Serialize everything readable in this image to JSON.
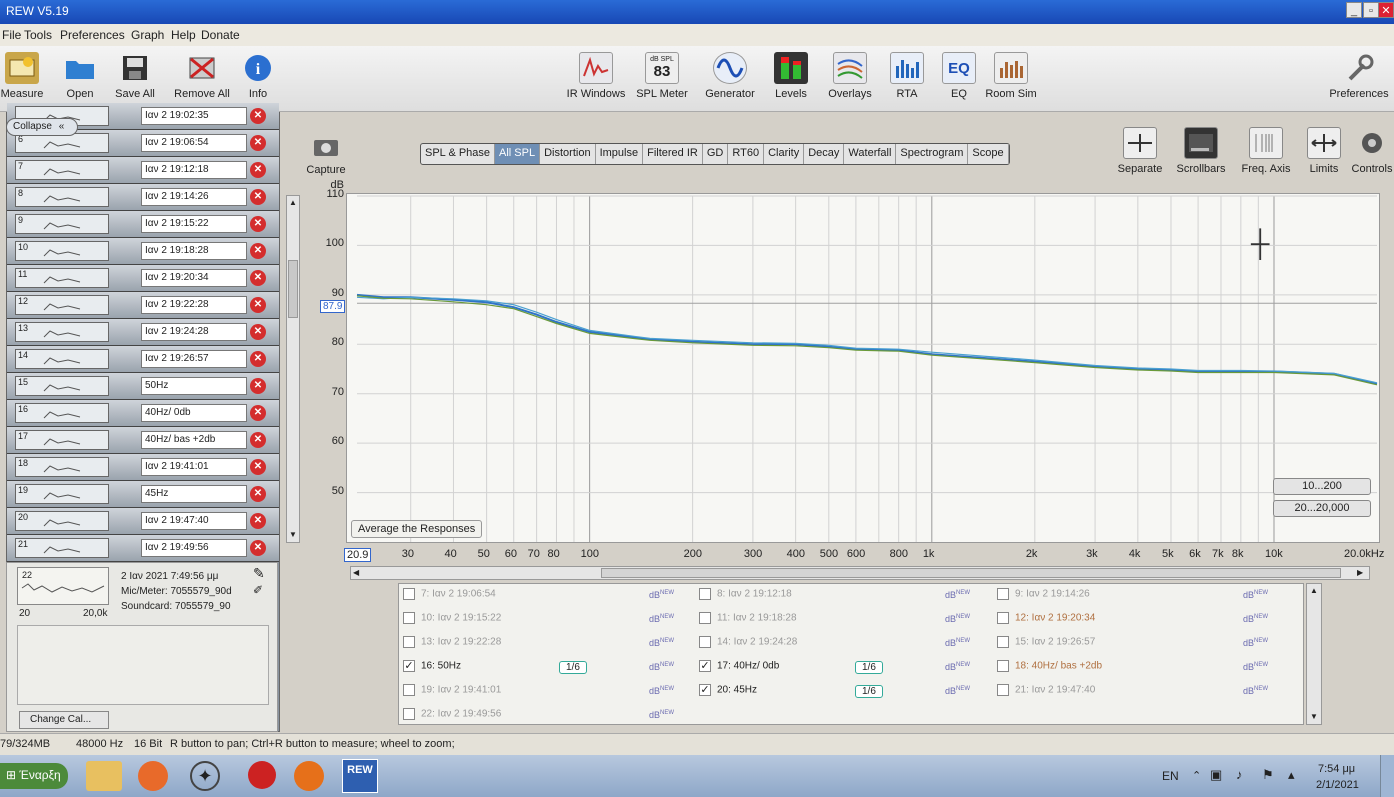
{
  "window": {
    "title": "REW V5.19"
  },
  "menu": [
    "File",
    "Tools",
    "Preferences",
    "Graph",
    "Help",
    "Donate"
  ],
  "toolbar_left": [
    {
      "label": "Measure",
      "icon": "measure-icon"
    },
    {
      "label": "Open",
      "icon": "folder-icon"
    },
    {
      "label": "Save All",
      "icon": "save-icon"
    },
    {
      "label": "Remove All",
      "icon": "remove-icon"
    },
    {
      "label": "Info",
      "icon": "info-icon"
    }
  ],
  "toolbar_center": [
    {
      "label": "IR Windows",
      "icon": "ir-windows-icon"
    },
    {
      "label": "SPL Meter",
      "icon": "spl-meter-icon",
      "badge": "83",
      "badge_top": "dB SPL"
    },
    {
      "label": "Generator",
      "icon": "generator-icon"
    },
    {
      "label": "Levels",
      "icon": "levels-icon"
    },
    {
      "label": "Overlays",
      "icon": "overlays-icon"
    },
    {
      "label": "RTA",
      "icon": "rta-icon"
    },
    {
      "label": "EQ",
      "icon": "eq-icon"
    },
    {
      "label": "Room Sim",
      "icon": "room-sim-icon"
    }
  ],
  "toolbar_right": {
    "label": "Preferences"
  },
  "graph_controls": [
    {
      "label": "Separate"
    },
    {
      "label": "Scrollbars"
    },
    {
      "label": "Freq. Axis"
    },
    {
      "label": "Limits"
    },
    {
      "label": "Controls"
    }
  ],
  "capture": {
    "label": "Capture"
  },
  "sidebar": {
    "collapse_label": "Collapse",
    "measurements": [
      {
        "num": "",
        "name": "Ιαν 2 19:02:35"
      },
      {
        "num": "6",
        "name": "Ιαν 2 19:06:54"
      },
      {
        "num": "7",
        "name": "Ιαν 2 19:12:18"
      },
      {
        "num": "8",
        "name": "Ιαν 2 19:14:26"
      },
      {
        "num": "9",
        "name": "Ιαν 2 19:15:22"
      },
      {
        "num": "10",
        "name": "Ιαν 2 19:18:28"
      },
      {
        "num": "11",
        "name": "Ιαν 2 19:20:34"
      },
      {
        "num": "12",
        "name": "Ιαν 2 19:22:28"
      },
      {
        "num": "13",
        "name": "Ιαν 2 19:24:28"
      },
      {
        "num": "14",
        "name": "Ιαν 2 19:26:57"
      },
      {
        "num": "15",
        "name": "50Hz"
      },
      {
        "num": "16",
        "name": "40Hz/ 0db"
      },
      {
        "num": "17",
        "name": "40Hz/ bas +2db"
      },
      {
        "num": "18",
        "name": "Ιαν 2 19:41:01"
      },
      {
        "num": "19",
        "name": "45Hz"
      },
      {
        "num": "20",
        "name": "Ιαν 2 19:47:40"
      },
      {
        "num": "21",
        "name": "Ιαν 2 19:49:56"
      }
    ],
    "info": {
      "num": "22",
      "date": "2 Ιαν 2021 7:49:56 μμ",
      "mic": "Mic/Meter: 7055579_90d",
      "soundcard": "Soundcard: 7055579_90",
      "range_lo": "20",
      "range_hi": "20,0k",
      "change_cal": "Change Cal..."
    }
  },
  "tabs": [
    "SPL & Phase",
    "All SPL",
    "Distortion",
    "Impulse",
    "Filtered IR",
    "GD",
    "RT60",
    "Clarity",
    "Decay",
    "Waterfall",
    "Spectrogram",
    "Scope"
  ],
  "active_tab": "All SPL",
  "plot": {
    "yunit": "dB",
    "yticks": [
      "110",
      "100",
      "90",
      "80",
      "70",
      "60",
      "50"
    ],
    "cursor_value": "87.9",
    "xticks": [
      "20.9",
      "30",
      "40",
      "50",
      "60",
      "70",
      "80",
      "100",
      "200",
      "300",
      "400",
      "500",
      "600",
      "800",
      "1k",
      "2k",
      "3k",
      "4k",
      "5k",
      "6k",
      "7k",
      "8k",
      "10k",
      "20.0kHz"
    ],
    "average_button": "Average the Responses",
    "range_btn1": "10...200",
    "range_btn2": "20...20,000"
  },
  "chart_data": {
    "type": "line",
    "xscale": "log",
    "xlim": [
      20.9,
      20000
    ],
    "ylim": [
      40,
      110
    ],
    "ylabel": "dB",
    "x": [
      20.9,
      25,
      30,
      40,
      50,
      60,
      70,
      80,
      100,
      150,
      200,
      300,
      400,
      500,
      600,
      800,
      1000,
      2000,
      3000,
      4000,
      5000,
      6000,
      8000,
      10000,
      15000,
      20000
    ],
    "series": [
      {
        "values": [
          90,
          89.5,
          89.5,
          89,
          88.5,
          87.5,
          86,
          84.5,
          82.5,
          81,
          80.5,
          80,
          80,
          79.5,
          79,
          78.8,
          78,
          76.5,
          75.5,
          75,
          74.8,
          74.5,
          74.5,
          74.5,
          74,
          72
        ],
        "color": "#2f74c8"
      },
      {
        "values": [
          89.5,
          89.2,
          89.5,
          89.2,
          88.8,
          88,
          86.5,
          85,
          82.8,
          81.2,
          80.8,
          80.3,
          80.2,
          79.8,
          79.2,
          79,
          78.4,
          76.8,
          75.7,
          75.2,
          75,
          74.7,
          74.7,
          74.6,
          74.1,
          72.2
        ],
        "color": "#4aa0d0"
      },
      {
        "values": [
          89.8,
          89.3,
          89.2,
          88.6,
          88,
          87.2,
          85.6,
          84.2,
          82.2,
          80.8,
          80.3,
          79.8,
          79.7,
          79.3,
          78.8,
          78.6,
          77.8,
          76.3,
          75.3,
          74.8,
          74.6,
          74.3,
          74.3,
          74.3,
          73.8,
          71.8
        ],
        "color": "#6a9a3a"
      }
    ]
  },
  "legend": [
    {
      "label": "7: Ιαν 2 19:06:54",
      "checked": false,
      "smooth": ""
    },
    {
      "label": "8: Ιαν 2 19:12:18",
      "checked": false,
      "smooth": ""
    },
    {
      "label": "9: Ιαν 2 19:14:26",
      "checked": false,
      "smooth": ""
    },
    {
      "label": "10: Ιαν 2 19:15:22",
      "checked": false,
      "smooth": ""
    },
    {
      "label": "11: Ιαν 2 19:18:28",
      "checked": false,
      "smooth": ""
    },
    {
      "label": "12: Ιαν 2 19:20:34",
      "checked": false,
      "smooth": ""
    },
    {
      "label": "13: Ιαν 2 19:22:28",
      "checked": false,
      "smooth": ""
    },
    {
      "label": "14: Ιαν 2 19:24:28",
      "checked": false,
      "smooth": ""
    },
    {
      "label": "15: Ιαν 2 19:26:57",
      "checked": false,
      "smooth": ""
    },
    {
      "label": "16: 50Hz",
      "checked": true,
      "smooth": "1/6"
    },
    {
      "label": "17: 40Hz/ 0db",
      "checked": true,
      "smooth": "1/6"
    },
    {
      "label": "18: 40Hz/ bas +2db",
      "checked": false,
      "smooth": ""
    },
    {
      "label": "19: Ιαν 2 19:41:01",
      "checked": false,
      "smooth": ""
    },
    {
      "label": "20: 45Hz",
      "checked": true,
      "smooth": "1/6"
    },
    {
      "label": "21: Ιαν 2 19:47:40",
      "checked": false,
      "smooth": ""
    },
    {
      "label": "22: Ιαν 2 19:49:56",
      "checked": false,
      "smooth": ""
    }
  ],
  "legend_db": "dB",
  "legend_db_sup": "NEW",
  "status": {
    "memory": "79/324MB",
    "rate": "48000 Hz",
    "bits": "16 Bit",
    "hint": "R button to pan; Ctrl+R button to measure; wheel to zoom;"
  },
  "taskbar": {
    "start": "Έναρξη",
    "lang": "EN",
    "time": "7:54 μμ",
    "date": "2/1/2021"
  }
}
